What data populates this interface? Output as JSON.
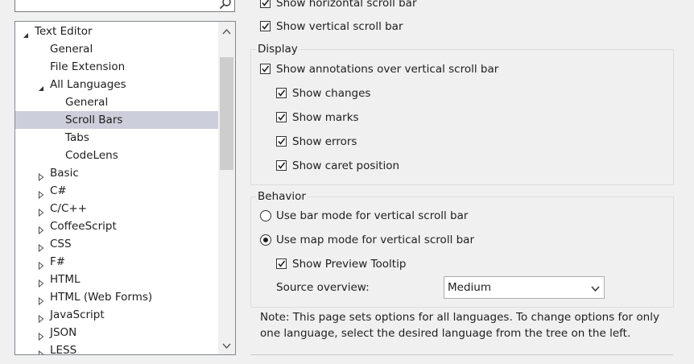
{
  "search": {
    "value": "",
    "icon": "search-icon"
  },
  "tree": {
    "items": [
      {
        "label": "Text Editor",
        "level": 0,
        "expander": "expanded"
      },
      {
        "label": "General",
        "level": 1,
        "expander": "none"
      },
      {
        "label": "File Extension",
        "level": 1,
        "expander": "none"
      },
      {
        "label": "All Languages",
        "level": 1,
        "expander": "expanded"
      },
      {
        "label": "General",
        "level": 2,
        "expander": "none"
      },
      {
        "label": "Scroll Bars",
        "level": 2,
        "expander": "none",
        "selected": true
      },
      {
        "label": "Tabs",
        "level": 2,
        "expander": "none"
      },
      {
        "label": "CodeLens",
        "level": 2,
        "expander": "none"
      },
      {
        "label": "Basic",
        "level": 1,
        "expander": "collapsed"
      },
      {
        "label": "C#",
        "level": 1,
        "expander": "collapsed"
      },
      {
        "label": "C/C++",
        "level": 1,
        "expander": "collapsed"
      },
      {
        "label": "CoffeeScript",
        "level": 1,
        "expander": "collapsed"
      },
      {
        "label": "CSS",
        "level": 1,
        "expander": "collapsed"
      },
      {
        "label": "F#",
        "level": 1,
        "expander": "collapsed"
      },
      {
        "label": "HTML",
        "level": 1,
        "expander": "collapsed"
      },
      {
        "label": "HTML (Web Forms)",
        "level": 1,
        "expander": "collapsed"
      },
      {
        "label": "JavaScript",
        "level": 1,
        "expander": "collapsed"
      },
      {
        "label": "JSON",
        "level": 1,
        "expander": "collapsed"
      },
      {
        "label": "LESS",
        "level": 1,
        "expander": "collapsed"
      }
    ]
  },
  "options": {
    "show_horizontal": {
      "label": "Show horizontal scroll bar",
      "checked": true
    },
    "show_vertical": {
      "label": "Show vertical scroll bar",
      "checked": true
    }
  },
  "display": {
    "title": "Display",
    "annotations": {
      "label": "Show annotations over vertical scroll bar",
      "checked": true
    },
    "changes": {
      "label": "Show changes",
      "checked": true
    },
    "marks": {
      "label": "Show marks",
      "checked": true
    },
    "errors": {
      "label": "Show errors",
      "checked": true
    },
    "caret": {
      "label": "Show caret position",
      "checked": true
    }
  },
  "behavior": {
    "title": "Behavior",
    "bar_mode": {
      "label": "Use bar mode for vertical scroll bar",
      "selected": false
    },
    "map_mode": {
      "label": "Use map mode for vertical scroll bar",
      "selected": true
    },
    "preview_tooltip": {
      "label": "Show Preview Tooltip",
      "checked": true
    },
    "source_overview_label": "Source overview:",
    "source_overview_value": "Medium"
  },
  "note": {
    "line1": "Note: This page sets options for all languages. To change options for only",
    "line2": "one language, select the desired language from the tree on the left."
  }
}
